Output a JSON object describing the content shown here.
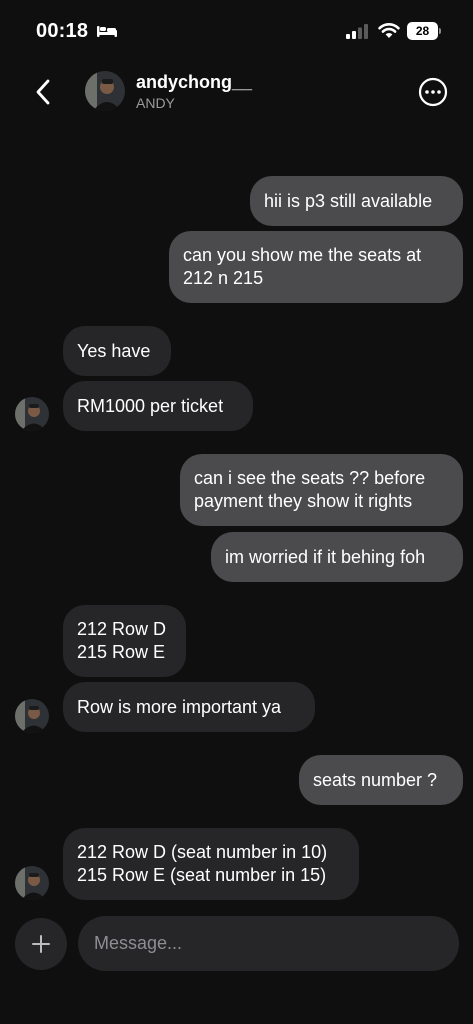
{
  "status_bar": {
    "time": "00:18",
    "battery": "28"
  },
  "header": {
    "name": "andychong__",
    "subtitle": "ANDY"
  },
  "messages": [
    {
      "dir": "out",
      "text": "hii is p3 still available"
    },
    {
      "dir": "out",
      "lines": [
        "can you show me the seats at",
        "212 n 215"
      ]
    },
    {
      "dir": "in",
      "text": "Yes have"
    },
    {
      "dir": "in",
      "text": "RM1000 per ticket"
    },
    {
      "dir": "out",
      "lines": [
        "can i see the seats ?? before",
        "payment they show it rights"
      ]
    },
    {
      "dir": "out",
      "text": "im worried if it behing foh"
    },
    {
      "dir": "in",
      "lines": [
        "212 Row D",
        "215 Row E"
      ]
    },
    {
      "dir": "in",
      "text": "Row is more important ya"
    },
    {
      "dir": "out",
      "text": "seats number ?"
    },
    {
      "dir": "in",
      "lines": [
        "212 Row D (seat number in 10)",
        "215 Row E (seat number in 15)"
      ]
    }
  ],
  "composer": {
    "placeholder": "Message..."
  }
}
